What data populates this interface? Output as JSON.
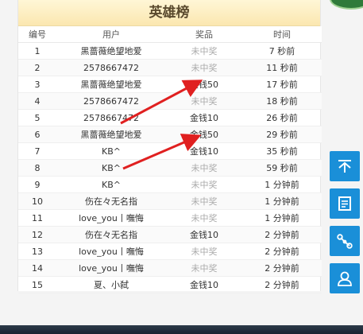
{
  "board": {
    "title": "英雄榜",
    "columns": {
      "no": "编号",
      "user": "用户",
      "prize": "奖品",
      "time": "时间"
    },
    "rows": [
      {
        "no": "1",
        "user": "黑蔷薇绝望地爱",
        "prize": "未中奖",
        "won": false,
        "time": "7 秒前"
      },
      {
        "no": "2",
        "user": "2578667472",
        "prize": "未中奖",
        "won": false,
        "time": "11 秒前"
      },
      {
        "no": "3",
        "user": "黑蔷薇绝望地爱",
        "prize": "金钱50",
        "won": true,
        "time": "17 秒前"
      },
      {
        "no": "4",
        "user": "2578667472",
        "prize": "未中奖",
        "won": false,
        "time": "18 秒前"
      },
      {
        "no": "5",
        "user": "2578667472",
        "prize": "金钱10",
        "won": true,
        "time": "26 秒前"
      },
      {
        "no": "6",
        "user": "黑蔷薇绝望地爱",
        "prize": "金钱50",
        "won": true,
        "time": "29 秒前"
      },
      {
        "no": "7",
        "user": "KB^",
        "prize": "金钱10",
        "won": true,
        "time": "35 秒前"
      },
      {
        "no": "8",
        "user": "KB^",
        "prize": "未中奖",
        "won": false,
        "time": "59 秒前"
      },
      {
        "no": "9",
        "user": "KB^",
        "prize": "未中奖",
        "won": false,
        "time": "1 分钟前"
      },
      {
        "no": "10",
        "user": "伤在々无名指",
        "prize": "未中奖",
        "won": false,
        "time": "1 分钟前"
      },
      {
        "no": "11",
        "user": "love_you丨嘸悔",
        "prize": "未中奖",
        "won": false,
        "time": "1 分钟前"
      },
      {
        "no": "12",
        "user": "伤在々无名指",
        "prize": "金钱10",
        "won": true,
        "time": "2 分钟前"
      },
      {
        "no": "13",
        "user": "love_you丨嘸悔",
        "prize": "未中奖",
        "won": false,
        "time": "2 分钟前"
      },
      {
        "no": "14",
        "user": "love_you丨嘸悔",
        "prize": "未中奖",
        "won": false,
        "time": "2 分钟前"
      },
      {
        "no": "15",
        "user": "夏、小弑",
        "prize": "金钱10",
        "won": true,
        "time": "2 分钟前"
      }
    ]
  },
  "sidebar": {
    "buttons": [
      {
        "name": "back-to-top-button",
        "icon": "arrow-up-icon"
      },
      {
        "name": "notes-button",
        "icon": "document-icon"
      },
      {
        "name": "share-button",
        "icon": "share-icon"
      },
      {
        "name": "customer-service-button",
        "icon": "user-icon"
      }
    ]
  },
  "colors": {
    "accent": "#1a8fd8",
    "title_bg": "#fbe7b0",
    "annotation_arrow": "#e02020",
    "no_prize": "#aaaaaa"
  }
}
